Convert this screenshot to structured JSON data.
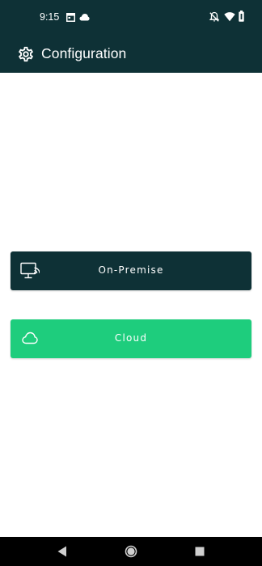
{
  "status_bar": {
    "time": "9:15",
    "left_icons": [
      "calendar-icon",
      "cloud-icon"
    ],
    "right_icons": [
      "notifications-off-icon",
      "wifi-icon",
      "battery-icon"
    ]
  },
  "app_bar": {
    "title": "Configuration",
    "icon": "settings-icon",
    "background": "#0e3136"
  },
  "options": [
    {
      "label": "On-Premise",
      "icon": "desktop-cast-icon",
      "background": "#0e3136"
    },
    {
      "label": "Cloud",
      "icon": "cloud-outline-icon",
      "background": "#1ecd7d"
    }
  ],
  "navigation_bar": {
    "buttons": [
      "back-icon",
      "home-icon",
      "recents-icon"
    ]
  }
}
